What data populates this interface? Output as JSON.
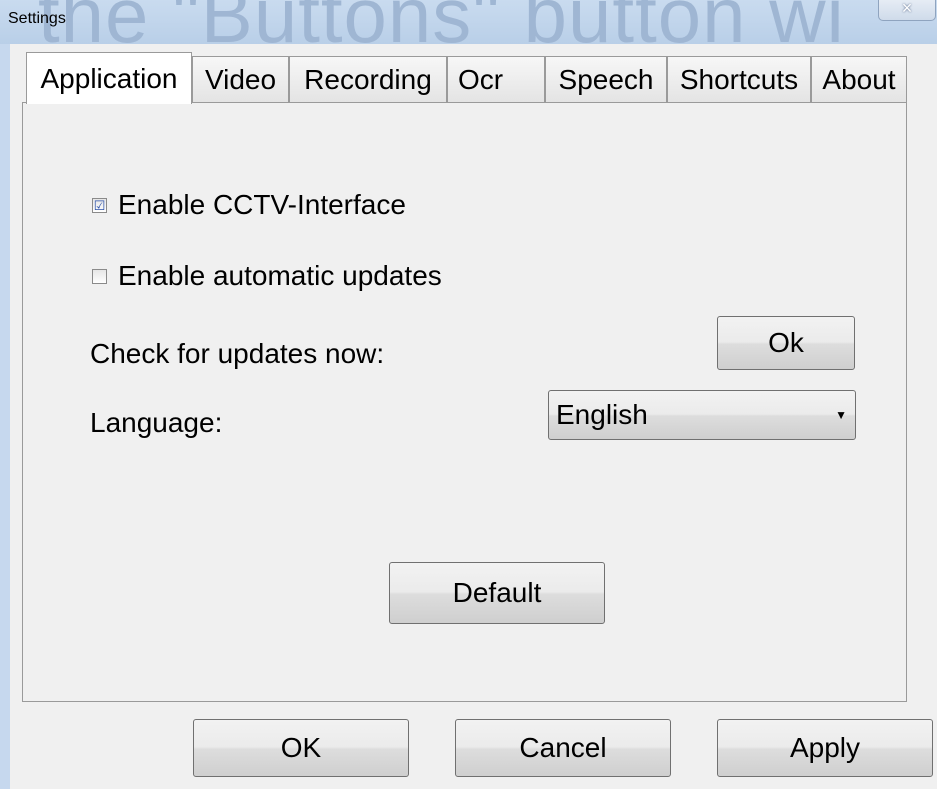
{
  "window": {
    "title": "Settings",
    "background_text": "the \"Buttons\" button wi",
    "close_glyph": "×"
  },
  "tabs": [
    {
      "label": "Application",
      "active": true
    },
    {
      "label": "Video"
    },
    {
      "label": "Recording"
    },
    {
      "label": "Ocr"
    },
    {
      "label": "Speech"
    },
    {
      "label": "Shortcuts"
    },
    {
      "label": "About"
    }
  ],
  "application": {
    "cctv": {
      "label": "Enable CCTV-Interface",
      "checked": true,
      "mark": "☑"
    },
    "auto_updates": {
      "label": "Enable automatic updates",
      "checked": false,
      "mark": ""
    },
    "check_updates": {
      "label": "Check for updates now:",
      "button": "Ok"
    },
    "language": {
      "label": "Language:",
      "value": "English",
      "arrow": "▼"
    },
    "default_button": "Default"
  },
  "footer": {
    "ok": "OK",
    "cancel": "Cancel",
    "apply": "Apply"
  },
  "colors": {
    "titlebar": "#c9dbef",
    "panel": "#f0f0f0",
    "check_mark": "#2a50a8"
  }
}
